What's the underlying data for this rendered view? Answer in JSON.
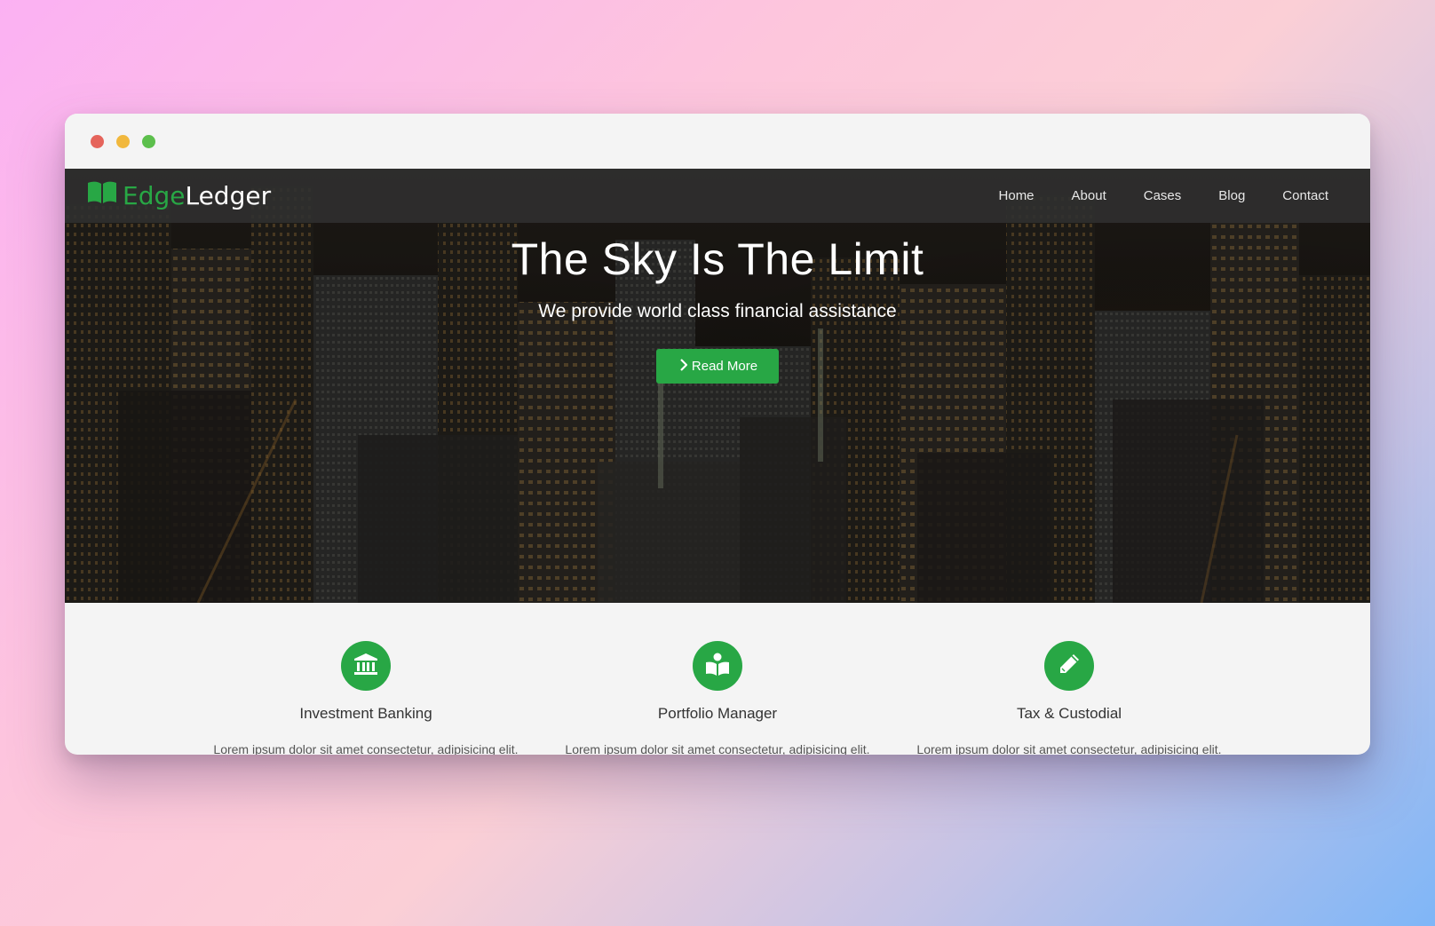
{
  "colors": {
    "accent": "#28a745",
    "navbar": "#303030",
    "window_bg": "#f4f4f4"
  },
  "brand": {
    "icon": "book-open-icon",
    "part1": "Edge",
    "part2": "Ledger"
  },
  "nav": {
    "items": [
      {
        "label": "Home"
      },
      {
        "label": "About"
      },
      {
        "label": "Cases"
      },
      {
        "label": "Blog"
      },
      {
        "label": "Contact"
      }
    ]
  },
  "hero": {
    "title": "The Sky Is The Limit",
    "subtitle": "We provide world class financial assistance",
    "button": {
      "label": "Read More",
      "icon": "chevron-right-icon"
    }
  },
  "features": [
    {
      "icon": "bank-icon",
      "title": "Investment Banking",
      "text": "Lorem ipsum dolor sit amet consectetur, adipisicing elit."
    },
    {
      "icon": "book-reader-icon",
      "title": "Portfolio Manager",
      "text": "Lorem ipsum dolor sit amet consectetur, adipisicing elit."
    },
    {
      "icon": "pencil-icon",
      "title": "Tax & Custodial",
      "text": "Lorem ipsum dolor sit amet consectetur, adipisicing elit."
    }
  ]
}
